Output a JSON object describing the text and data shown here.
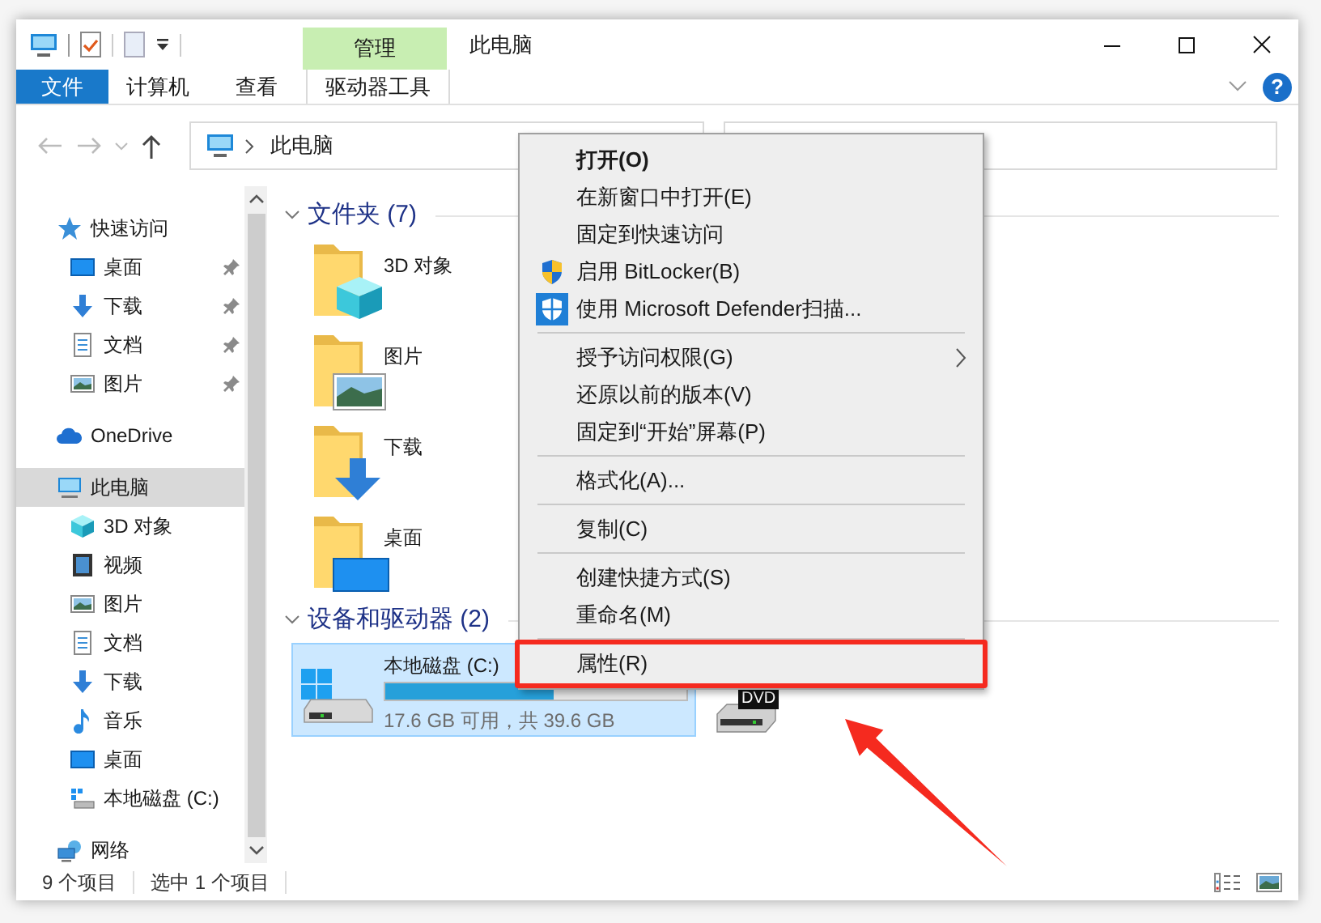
{
  "title_bar": {
    "context_tab": "管理",
    "title": "此电脑"
  },
  "ribbon_tabs": [
    {
      "label": "文件",
      "kind": "file"
    },
    {
      "label": "计算机",
      "kind": "plain"
    },
    {
      "label": "查看",
      "kind": "plain"
    },
    {
      "label": "驱动器工具",
      "kind": "contextual"
    }
  ],
  "help_button": "?",
  "address_bar": {
    "path": "此电脑"
  },
  "sidebar": {
    "items": [
      {
        "label": "快速访问",
        "kind": "star",
        "selected": false,
        "children": [
          {
            "label": "桌面",
            "kind": "desktop",
            "pinned": true,
            "selected": false
          },
          {
            "label": "下载",
            "kind": "download",
            "pinned": true,
            "selected": false
          },
          {
            "label": "文档",
            "kind": "document",
            "pinned": true,
            "selected": false
          },
          {
            "label": "图片",
            "kind": "picture",
            "pinned": true,
            "selected": false
          }
        ]
      },
      {
        "label": "OneDrive",
        "kind": "cloud",
        "selected": false
      },
      {
        "label": "此电脑",
        "kind": "pc",
        "selected": true,
        "children": [
          {
            "label": "3D 对象",
            "kind": "cube",
            "pinned": false,
            "selected": false
          },
          {
            "label": "视频",
            "kind": "video",
            "pinned": false,
            "selected": false
          },
          {
            "label": "图片",
            "kind": "picture",
            "pinned": false,
            "selected": false
          },
          {
            "label": "文档",
            "kind": "document",
            "pinned": false,
            "selected": false
          },
          {
            "label": "下载",
            "kind": "download",
            "pinned": false,
            "selected": false
          },
          {
            "label": "音乐",
            "kind": "music",
            "pinned": false,
            "selected": false
          },
          {
            "label": "桌面",
            "kind": "desktop",
            "pinned": false,
            "selected": false
          },
          {
            "label": "本地磁盘 (C:)",
            "kind": "drive",
            "pinned": false,
            "selected": false
          }
        ]
      },
      {
        "label": "网络",
        "kind": "network",
        "selected": false
      }
    ]
  },
  "groups": [
    {
      "title": "文件夹 (7)",
      "kind": "folders",
      "items": [
        {
          "name": "3D 对象",
          "kind": "cube"
        },
        {
          "name": "图片",
          "kind": "picture"
        },
        {
          "name": "下载",
          "kind": "download"
        },
        {
          "name": "桌面",
          "kind": "desktop"
        }
      ]
    },
    {
      "title": "设备和驱动器 (2)",
      "kind": "drives",
      "items": [
        {
          "kind": "local_disk",
          "name": "本地磁盘 (C:)",
          "level": 0.56,
          "space": "17.6 GB 可用，共 39.6 GB",
          "selected": true
        },
        {
          "kind": "dvd",
          "label": "DVD",
          "selected": false
        }
      ]
    }
  ],
  "context_menu": {
    "items": [
      {
        "kind": "command",
        "label": "打开(O)",
        "default": true,
        "highlighted": false
      },
      {
        "kind": "command",
        "label": "在新窗口中打开(E)",
        "default": false,
        "highlighted": false
      },
      {
        "kind": "command",
        "label": "固定到快速访问",
        "default": false,
        "highlighted": false
      },
      {
        "kind": "shield_command",
        "label": "启用 BitLocker(B)",
        "default": false,
        "highlighted": false
      },
      {
        "kind": "defender_command",
        "label": "使用 Microsoft Defender扫描...",
        "default": false,
        "highlighted": false
      },
      {
        "kind": "separator"
      },
      {
        "kind": "submenu",
        "label": "授予访问权限(G)",
        "default": false,
        "highlighted": false
      },
      {
        "kind": "command",
        "label": "还原以前的版本(V)",
        "default": false,
        "highlighted": false
      },
      {
        "kind": "command",
        "label": "固定到“开始”屏幕(P)",
        "default": false,
        "highlighted": false
      },
      {
        "kind": "separator"
      },
      {
        "kind": "command",
        "label": "格式化(A)...",
        "default": false,
        "highlighted": false
      },
      {
        "kind": "separator"
      },
      {
        "kind": "command",
        "label": "复制(C)",
        "default": false,
        "highlighted": false
      },
      {
        "kind": "separator"
      },
      {
        "kind": "command",
        "label": "创建快捷方式(S)",
        "default": false,
        "highlighted": false
      },
      {
        "kind": "command",
        "label": "重命名(M)",
        "default": false,
        "highlighted": false
      },
      {
        "kind": "separator"
      },
      {
        "kind": "command",
        "label": "属性(R)",
        "default": false,
        "highlighted": true
      }
    ]
  },
  "status_bar": {
    "item_count": "9 个项目",
    "selection": "选中 1 个项目"
  }
}
